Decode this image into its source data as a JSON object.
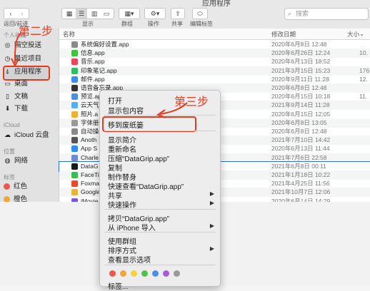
{
  "window": {
    "title": "应用程序"
  },
  "toolbar": {
    "back_label": "返回/前进",
    "view_label": "显示",
    "group_label": "群组",
    "action_label": "操作",
    "share_label": "共享",
    "tags_label": "编辑标签",
    "search_placeholder": "搜索"
  },
  "sidebar": {
    "favorites_head": "个人收藏",
    "items": [
      {
        "label": "隔空投送",
        "icon": "airdrop-icon"
      },
      {
        "label": "最近项目",
        "icon": "clock-icon"
      },
      {
        "label": "应用程序",
        "icon": "apps-icon"
      },
      {
        "label": "桌面",
        "icon": "desktop-icon"
      },
      {
        "label": "文稿",
        "icon": "doc-icon"
      },
      {
        "label": "下载",
        "icon": "download-icon"
      }
    ],
    "icloud_head": "iCloud",
    "icloud_item": "iCloud 云盘",
    "location_head": "位置",
    "location_item": "网络",
    "tags_head": "标签",
    "tags": [
      {
        "label": "红色",
        "color": "#f0564b"
      },
      {
        "label": "橙色",
        "color": "#f5a33b"
      }
    ]
  },
  "list": {
    "col_name": "名称",
    "col_date": "修改日期",
    "col_size": "大小",
    "rows": [
      {
        "name": "系统偏好设置.app",
        "date": "2020年6月8日 12:48",
        "size": "",
        "color": "#8a8a8a"
      },
      {
        "name": "信息.app",
        "date": "2020年6月26日 12:24",
        "size": "10.",
        "color": "#3bc53b"
      },
      {
        "name": "音乐.app",
        "date": "2020年6月13日 18:52",
        "size": "",
        "color": "#f0405a"
      },
      {
        "name": "印象笔记.app",
        "date": "2021年3月15日 15:23",
        "size": "176",
        "color": "#2dbe60"
      },
      {
        "name": "邮件.app",
        "date": "2020年9月11日 11:28",
        "size": "12.",
        "color": "#3b8ef0"
      },
      {
        "name": "语音备忘录.app",
        "date": "2020年6月8日 12:48",
        "size": "",
        "color": "#333"
      },
      {
        "name": "预览.app",
        "date": "2020年6月15日 10:18",
        "size": "11.",
        "color": "#4c92d8"
      },
      {
        "name": "云天气",
        "date": "2021年9月14日 11:28",
        "size": "",
        "color": "#55aef2"
      },
      {
        "name": "照片.a",
        "date": "2020年6月15日 12:05",
        "size": "",
        "color": "#f0b030"
      },
      {
        "name": "字体册",
        "date": "2020年6月8日 13:05",
        "size": "",
        "color": "#999"
      },
      {
        "name": "自动操",
        "date": "2020年6月8日 12:48",
        "size": "",
        "color": "#8a8a8a"
      },
      {
        "name": "Anoth",
        "date": "2021年7月10日 14:42",
        "size": "",
        "color": "#555"
      },
      {
        "name": "App S",
        "date": "2020年6月13日 11:44",
        "size": "",
        "color": "#2d8ef5"
      },
      {
        "name": "Charle",
        "date": "2021年7月6日 22:58",
        "size": "",
        "color": "#6d8ad8"
      },
      {
        "name": "DataG",
        "date": "2021年6月8日 00:11",
        "size": "",
        "color": "#1a1a1a"
      },
      {
        "name": "FaceTi",
        "date": "2021年1月18日 10:22",
        "size": "",
        "color": "#33c14f"
      },
      {
        "name": "Foxma",
        "date": "2021年4月25日 11:56",
        "size": "",
        "color": "#e94a2b"
      },
      {
        "name": "Google",
        "date": "2021年10月7日 12:06",
        "size": "",
        "color": "#e9b531"
      },
      {
        "name": "iMovie",
        "date": "2020年6月14日 14:29",
        "size": "",
        "color": "#7a5ad8"
      }
    ]
  },
  "context_menu": {
    "items": [
      {
        "label": "打开"
      },
      {
        "label": "显示包内容"
      },
      {
        "label": "移到废纸篓"
      },
      {
        "label": "显示简介"
      },
      {
        "label": "重新命名"
      },
      {
        "label": "压缩“DataGrip.app”"
      },
      {
        "label": "复制"
      },
      {
        "label": "制作替身"
      },
      {
        "label": "快速查看“DataGrip.app”"
      },
      {
        "label": "共享"
      },
      {
        "label": "快速操作"
      },
      {
        "label": "拷贝“DataGrip.app”"
      },
      {
        "label": "从 iPhone 导入"
      },
      {
        "label": "使用群组"
      },
      {
        "label": "排序方式"
      },
      {
        "label": "查看显示选项"
      },
      {
        "label": "标签..."
      }
    ],
    "tag_colors": [
      "#f0564b",
      "#f5a33b",
      "#f5d33b",
      "#54c04a",
      "#4c8ef0",
      "#a75ad8",
      "#9a9a9a"
    ]
  },
  "annotations": {
    "step2": "第二步",
    "step3": "第三步",
    "accent_color": "#e53a1f"
  }
}
